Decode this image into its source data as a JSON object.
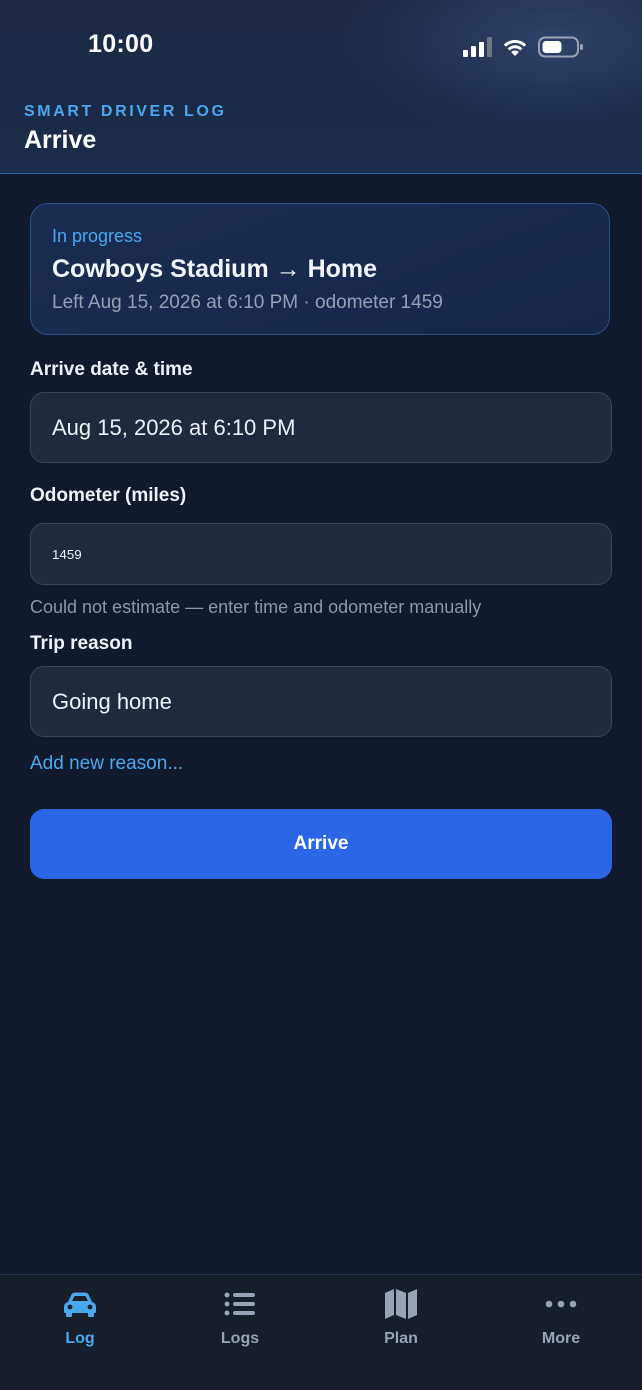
{
  "status_bar": {
    "time": "10:00"
  },
  "header": {
    "kicker": "SMART DRIVER LOG",
    "title": "Arrive"
  },
  "trip": {
    "status": "In progress",
    "route": "Cowboys Stadium → Home",
    "meta": "Left Aug 15, 2026 at 6:10 PM · odometer 1459"
  },
  "form": {
    "arrive_label": "Arrive date & time",
    "arrive_value": "Aug 15, 2026 at 6:10 PM",
    "odometer_label": "Odometer (miles)",
    "odometer_value": "1459",
    "hint": "Could not estimate — enter time and odometer manually",
    "reason_label": "Trip reason",
    "reason_value": "Going home",
    "add_reason": "Add new reason...",
    "submit_label": "Arrive"
  },
  "tabs": [
    {
      "label": "Log",
      "icon": "car-icon",
      "active": true
    },
    {
      "label": "Logs",
      "icon": "list-icon",
      "active": false
    },
    {
      "label": "Plan",
      "icon": "map-icon",
      "active": false
    },
    {
      "label": "More",
      "icon": "more-icon",
      "active": false
    }
  ],
  "colors": {
    "accent": "#4aa8f0",
    "primary_button": "#2a66e6",
    "background": "#111a2c"
  }
}
